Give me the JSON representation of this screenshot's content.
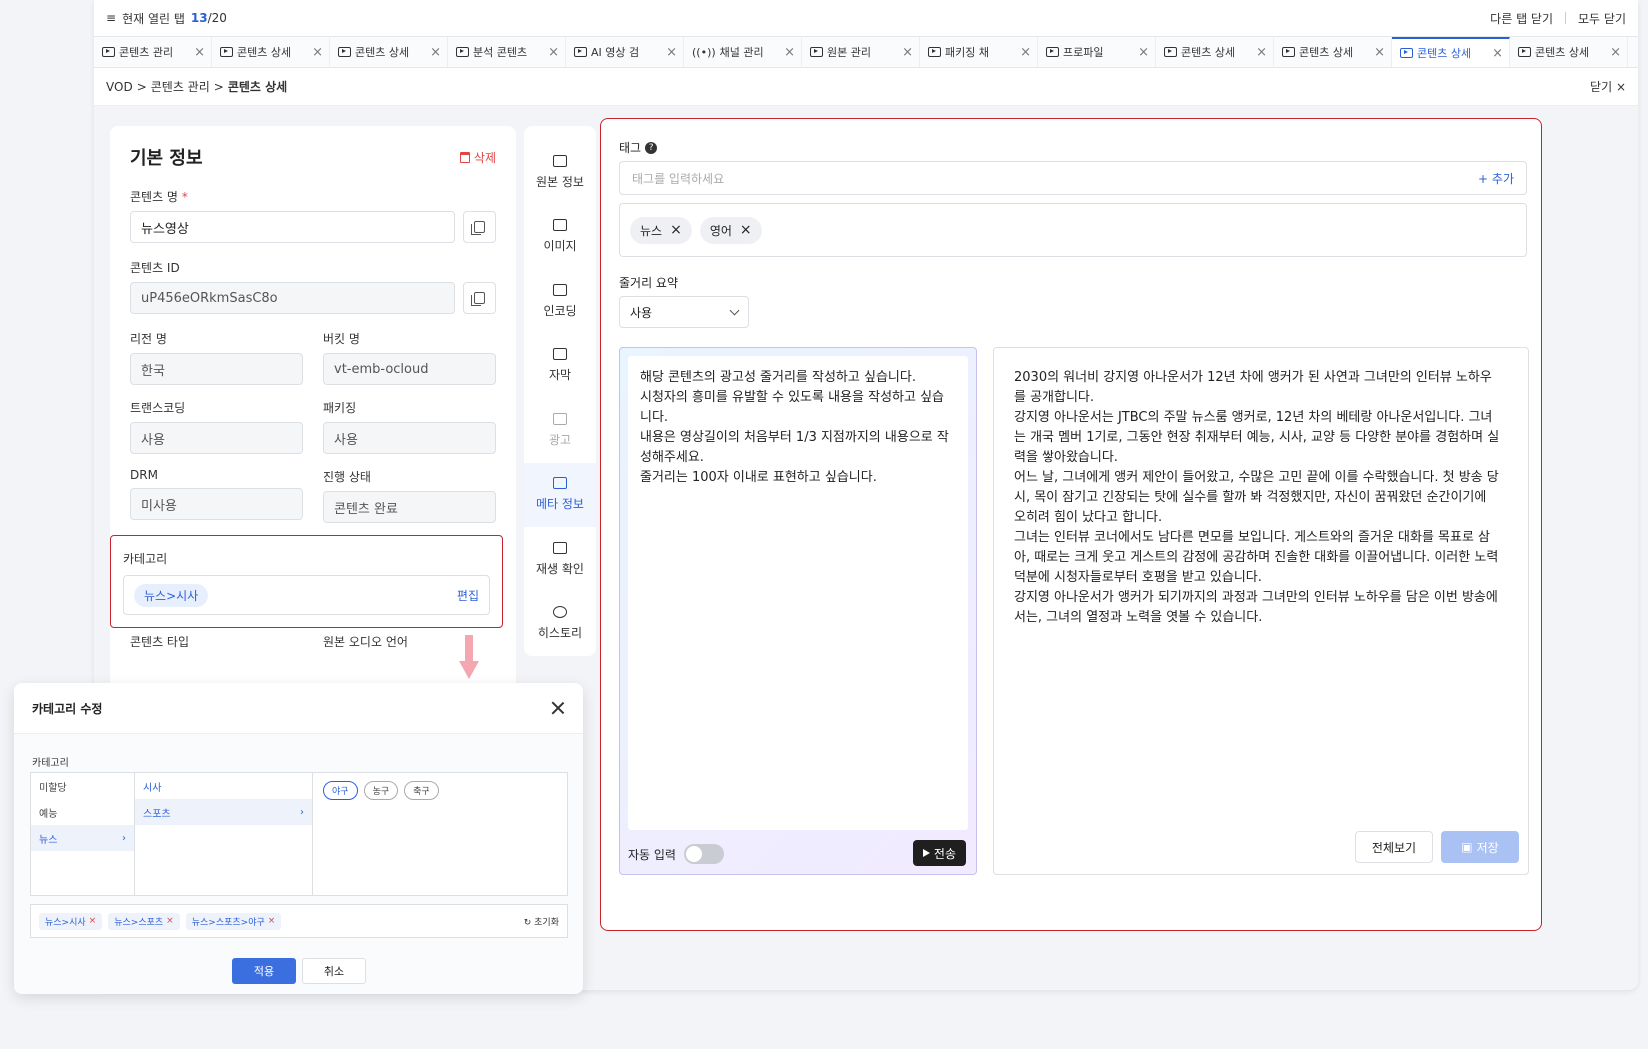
{
  "open_tabs": {
    "prefix": "현재 열린 탭",
    "count": "13",
    "total": "/20",
    "close_others": "다른 탭 닫기",
    "close_all": "모두 닫기"
  },
  "tabs": [
    {
      "label": "콘텐츠 관리"
    },
    {
      "label": "콘텐츠 상세"
    },
    {
      "label": "콘텐츠 상세"
    },
    {
      "label": "분석 콘텐츠"
    },
    {
      "label": "AI 영상 검"
    },
    {
      "label": "채널 관리"
    },
    {
      "label": "원본 관리"
    },
    {
      "label": "패키징 채"
    },
    {
      "label": "프로파일"
    },
    {
      "label": "콘텐츠 상세"
    },
    {
      "label": "콘텐츠 상세"
    },
    {
      "label": "콘텐츠 상세"
    },
    {
      "label": "콘텐츠 상세"
    }
  ],
  "breadcrumb": {
    "root": "VOD",
    "parent": "콘텐츠 관리",
    "current": "콘텐츠 상세",
    "close": "닫기"
  },
  "basic_info": {
    "title": "기본 정보",
    "delete": "삭제",
    "content_name_label": "콘텐츠 명",
    "content_name": "뉴스영상",
    "content_id_label": "콘텐츠 ID",
    "content_id": "uP456eORkmSasC8o",
    "region_label": "리전 명",
    "region": "한국",
    "bucket_label": "버킷 명",
    "bucket": "vt-emb-ocloud",
    "transcoding_label": "트랜스코딩",
    "transcoding": "사용",
    "packaging_label": "패키징",
    "packaging": "사용",
    "drm_label": "DRM",
    "drm": "미사용",
    "status_label": "진행 상태",
    "status": "콘텐츠 완료",
    "category_label": "카테고리",
    "category_chip": "뉴스>시사",
    "edit": "편집",
    "content_type_label": "콘텐츠 타입",
    "audio_lang_label": "원본 오디오 언어"
  },
  "sidenav": [
    {
      "label": "원본 정보"
    },
    {
      "label": "이미지"
    },
    {
      "label": "인코딩"
    },
    {
      "label": "자막"
    },
    {
      "label": "광고"
    },
    {
      "label": "메타 정보"
    },
    {
      "label": "재생 확인"
    },
    {
      "label": "히스토리"
    }
  ],
  "meta": {
    "tag_label": "태그",
    "tag_placeholder": "태그를 입력하세요",
    "add": "+ 추가",
    "tags": [
      "뉴스",
      "영어"
    ],
    "summary_label": "줄거리 요약",
    "summary_select": "사용",
    "prompt": "해당 콘텐츠의 광고성 줄거리를 작성하고 싶습니다.\n시청자의 흥미를 유발할 수 있도록 내용을 작성하고 싶습\n니다.\n내용은 영상길이의 처음부터 1/3 지점까지의 내용으로 작\n성해주세요.\n줄거리는 100자 이내로 표현하고 싶습니다.",
    "auto_input": "자동 입력",
    "send": "전송",
    "result": "2030의 워너비 강지영 아나운서가 12년 차에 앵커가 된 사연과 그녀만의 인터뷰 노하우\n를 공개합니다.\n강지영 아나운서는 JTBC의 주말 뉴스룸 앵커로, 12년 차의 베테랑 아나운서입니다. 그녀\n는 개국 멤버 1기로, 그동안 현장 취재부터 예능, 시사, 교양 등 다양한 분야를 경험하며 실\n력을 쌓아왔습니다.\n어느 날, 그녀에게 앵커 제안이 들어왔고, 수많은 고민 끝에 이를 수락했습니다. 첫 방송 당\n시, 목이 잠기고 긴장되는 탓에 실수를 할까 봐 걱정했지만, 자신이 꿈꿔왔던 순간이기에\n오히려 힘이 났다고 합니다.\n그녀는 인터뷰 코너에서도 남다른 면모를 보입니다. 게스트와의 즐거운 대화를 목표로 삼\n아, 때로는 크게 웃고 게스트의 감정에 공감하며 진솔한 대화를 이끌어냅니다. 이러한 노력\n덕분에 시청자들로부터 호평을 받고 있습니다.\n강지영 아나운서가 앵커가 되기까지의 과정과 그녀만의 인터뷰 노하우를 담은 이번 방송에\n서는, 그녀의 열정과 노력을 엿볼 수 있습니다.",
    "view_all": "전체보기",
    "save": "저장"
  },
  "modal": {
    "title": "카테고리 수정",
    "label": "카테고리",
    "col1": [
      "미할당",
      "예능",
      "뉴스"
    ],
    "col2": [
      "시사",
      "스포츠"
    ],
    "col3": [
      "야구",
      "농구",
      "축구"
    ],
    "selected": [
      "뉴스>시사",
      "뉴스>스포츠",
      "뉴스>스포츠>야구"
    ],
    "reset": "초기화",
    "apply": "적용",
    "cancel": "취소"
  },
  "colors": {
    "accent": "#2b5fd9",
    "highlight_border": "#c8232c"
  }
}
